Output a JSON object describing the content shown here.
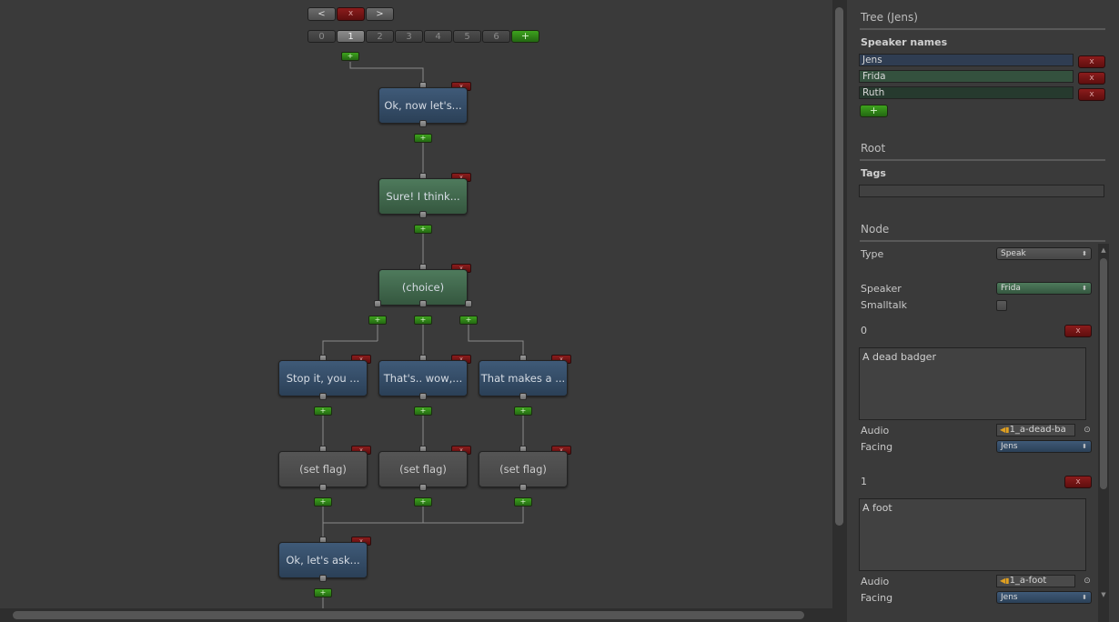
{
  "toolbar": {
    "prev_label": "<",
    "delete_label": "x",
    "next_label": ">",
    "tree_tabs": [
      "0",
      "1",
      "2",
      "3",
      "4",
      "5",
      "6"
    ],
    "selected_tab": "1",
    "add_tree_label": "+"
  },
  "graph": {
    "plus_label": "+",
    "x_label": "x",
    "nodes": [
      {
        "text": "Ok, now let's...",
        "style": "blue"
      },
      {
        "text": "Sure! I think...",
        "style": "green"
      },
      {
        "text": "(choice)",
        "style": "green"
      },
      {
        "text": "Stop it, you ...",
        "style": "blue"
      },
      {
        "text": "That's.. wow,...",
        "style": "blue"
      },
      {
        "text": "That makes a ...",
        "style": "blue"
      },
      {
        "text": "(set flag)",
        "style": "grey"
      },
      {
        "text": "(set flag)",
        "style": "grey"
      },
      {
        "text": "(set flag)",
        "style": "grey"
      },
      {
        "text": "Ok, let's ask...",
        "style": "blue"
      }
    ]
  },
  "panel": {
    "tree_title": "Tree (Jens)",
    "speaker_names_label": "Speaker names",
    "speakers": [
      {
        "name": "Jens",
        "color": "#2f3d52"
      },
      {
        "name": "Frida",
        "color": "#34513e"
      },
      {
        "name": "Ruth",
        "color": "#263a2e"
      }
    ],
    "remove_label": "x",
    "add_label": "+",
    "root_title": "Root",
    "tags_label": "Tags",
    "tags_value": "",
    "node_title": "Node",
    "type_label": "Type",
    "type_value": "Speak",
    "speaker_label": "Speaker",
    "speaker_value": "Frida",
    "smalltalk_label": "Smalltalk",
    "smalltalk_checked": false,
    "lines": [
      {
        "index": "0",
        "text": "A dead badger",
        "audio_label": "Audio",
        "audio_value": "1_a-dead-ba",
        "facing_label": "Facing",
        "facing_value": "Jens"
      },
      {
        "index": "1",
        "text": "A foot",
        "audio_label": "Audio",
        "audio_value": "1_a-foot",
        "facing_label": "Facing",
        "facing_value": "Jens"
      }
    ]
  },
  "icons": {
    "dropdown_arrows": "dropdown-arrows-icon",
    "audio_clip": "audio-clip-icon",
    "object_picker": "object-picker-icon"
  }
}
